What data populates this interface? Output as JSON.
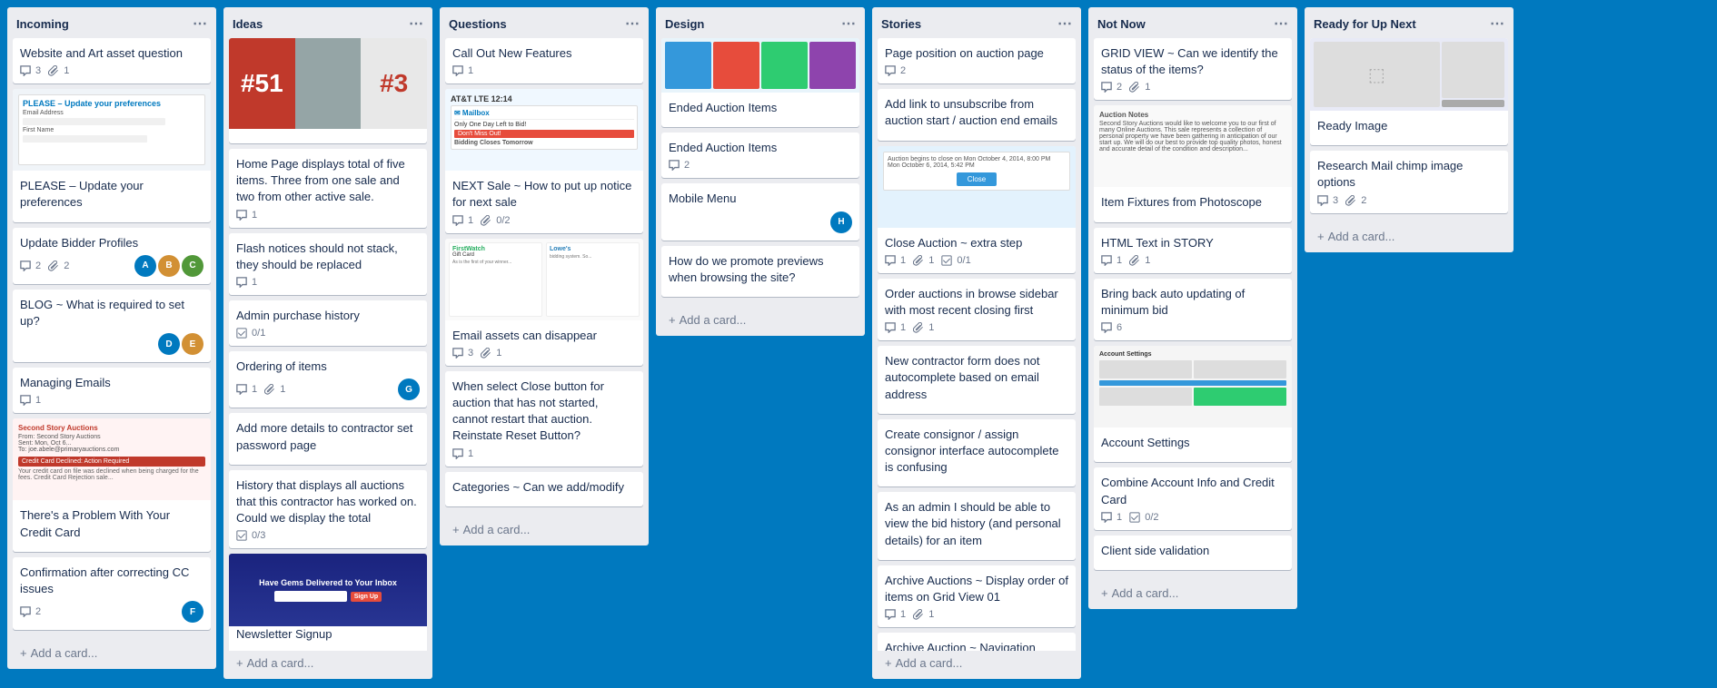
{
  "board": {
    "background": "#0079bf",
    "columns": [
      {
        "id": "incoming",
        "title": "Incoming",
        "cards": [
          {
            "id": "c1",
            "title": "Website and Art asset question",
            "comments": 3,
            "attachments": 1,
            "hasImage": false,
            "imageType": null,
            "avatars": [],
            "labels": []
          },
          {
            "id": "c2",
            "title": "PLEASE – Update your preferences",
            "hasImage": true,
            "imageType": "email-prefs",
            "comments": 0,
            "attachments": 0,
            "avatars": [],
            "labels": []
          },
          {
            "id": "c3",
            "title": "Update Bidder Profiles",
            "hasImage": false,
            "comments": 2,
            "attachments": 2,
            "avatars": [
              "A",
              "B",
              "C"
            ],
            "labels": []
          },
          {
            "id": "c4",
            "title": "BLOG ~ What is required to set up?",
            "hasImage": false,
            "comments": 0,
            "attachments": 0,
            "avatars": [
              "D",
              "E"
            ],
            "labels": []
          },
          {
            "id": "c5",
            "title": "Managing Emails",
            "hasImage": false,
            "comments": 1,
            "attachments": 0,
            "avatars": [],
            "labels": []
          },
          {
            "id": "c6",
            "title": "There's a Problem With Your Credit Card",
            "hasImage": true,
            "imageType": "credit-card",
            "comments": 0,
            "attachments": 0,
            "avatars": [],
            "labels": []
          },
          {
            "id": "c7",
            "title": "Confirmation after correcting CC issues",
            "hasImage": false,
            "comments": 2,
            "attachments": 0,
            "avatars": [
              "F"
            ],
            "labels": []
          }
        ]
      },
      {
        "id": "ideas",
        "title": "Ideas",
        "cards": [
          {
            "id": "i1",
            "title": "",
            "hasImage": true,
            "imageType": "ideas-top",
            "comments": 0,
            "attachments": 0,
            "avatars": [],
            "labels": []
          },
          {
            "id": "i2",
            "title": "Home Page displays total of five items. Three from one sale and two from other active sale.",
            "hasImage": false,
            "comments": 1,
            "attachments": 0,
            "avatars": [],
            "labels": []
          },
          {
            "id": "i3",
            "title": "Flash notices should not stack, they should be replaced",
            "hasImage": false,
            "comments": 1,
            "attachments": 0,
            "avatars": [],
            "labels": []
          },
          {
            "id": "i4",
            "title": "Admin purchase history",
            "hasImage": false,
            "comments": 0,
            "checklist": "0/1",
            "attachments": 0,
            "avatars": [],
            "labels": []
          },
          {
            "id": "i5",
            "title": "Ordering of items",
            "hasImage": false,
            "comments": 1,
            "attachments": 1,
            "avatars": [
              "G"
            ],
            "labels": []
          },
          {
            "id": "i6",
            "title": "Add more details to contractor set password page",
            "hasImage": false,
            "comments": 0,
            "attachments": 0,
            "avatars": [],
            "labels": [],
            "hasChecklist": true
          },
          {
            "id": "i7",
            "title": "History that displays all auctions that this contractor has worked on. Could we display the total",
            "hasImage": false,
            "comments": 0,
            "checklist": "0/3",
            "attachments": 0,
            "avatars": [],
            "labels": []
          },
          {
            "id": "i8",
            "title": "",
            "hasImage": true,
            "imageType": "newsletter",
            "comments": 0,
            "attachments": 0,
            "avatars": [],
            "labels": [],
            "cardTitle": "Newsletter Signup"
          }
        ]
      },
      {
        "id": "questions",
        "title": "Questions",
        "cards": [
          {
            "id": "q1",
            "title": "Call Out New Features",
            "hasImage": false,
            "comments": 1,
            "attachments": 0,
            "avatars": [],
            "labels": []
          },
          {
            "id": "q2",
            "title": "NEXT Sale ~ How to put up notice for next sale",
            "hasImage": true,
            "imageType": "next-sale",
            "comments": 1,
            "attachments": "0/2",
            "avatars": [],
            "labels": []
          },
          {
            "id": "q3",
            "title": "",
            "hasImage": true,
            "imageType": "phone-bid",
            "comments": 3,
            "attachments": 1,
            "avatars": [],
            "labels": [],
            "cardTitle": "Email assets can disappear"
          },
          {
            "id": "q4",
            "title": "When select Close button for auction that has not started, cannot restart that auction. Reinstate Reset Button?",
            "hasImage": false,
            "comments": 1,
            "attachments": 0,
            "avatars": [],
            "labels": []
          },
          {
            "id": "q5",
            "title": "Categories ~ Can we add/modify",
            "hasImage": false,
            "comments": 0,
            "attachments": 0,
            "avatars": [],
            "labels": []
          }
        ]
      },
      {
        "id": "design",
        "title": "Design",
        "cards": [
          {
            "id": "d1",
            "title": "",
            "hasImage": true,
            "imageType": "design-items",
            "comments": 0,
            "attachments": 0,
            "avatars": [],
            "labels": [],
            "cardTitle": "Ended Auction Items"
          },
          {
            "id": "d2",
            "title": "Ended Auction Items",
            "hasImage": false,
            "comments": 2,
            "attachments": 0,
            "avatars": [],
            "labels": []
          },
          {
            "id": "d3",
            "title": "Mobile Menu",
            "hasImage": false,
            "comments": 0,
            "attachments": 0,
            "avatars": [
              "H"
            ],
            "labels": []
          },
          {
            "id": "d4",
            "title": "How do we promote previews when browsing the site?",
            "hasImage": false,
            "comments": 0,
            "attachments": 0,
            "avatars": [],
            "labels": []
          },
          {
            "id": "d5",
            "title": "Add a card…",
            "isAddCard": true
          }
        ]
      },
      {
        "id": "stories",
        "title": "Stories",
        "cards": [
          {
            "id": "s1",
            "title": "Page position on auction page",
            "hasImage": false,
            "comments": 2,
            "attachments": 0,
            "avatars": [],
            "labels": []
          },
          {
            "id": "s2",
            "title": "Add link to unsubscribe from auction start / auction end emails",
            "hasImage": false,
            "comments": 0,
            "attachments": 0,
            "avatars": [],
            "labels": []
          },
          {
            "id": "s3",
            "title": "",
            "hasImage": true,
            "imageType": "story-close",
            "comments": 1,
            "attachments": 1,
            "checklist": "0/1",
            "avatars": [],
            "labels": [],
            "cardTitle": "Close Auction ~ extra step"
          },
          {
            "id": "s4",
            "title": "Order auctions in browse sidebar with most recent closing first",
            "hasImage": false,
            "comments": 1,
            "attachments": 1,
            "avatars": [],
            "labels": []
          },
          {
            "id": "s5",
            "title": "New contractor form does not autocomplete based on email address",
            "hasImage": false,
            "comments": 0,
            "attachments": 0,
            "avatars": [],
            "labels": []
          },
          {
            "id": "s6",
            "title": "Create consignor / assign consignor interface autocomplete is confusing",
            "hasImage": false,
            "comments": 0,
            "attachments": 0,
            "avatars": [],
            "labels": []
          },
          {
            "id": "s7",
            "title": "As an admin I should be able to view the bid history (and personal details) for an item",
            "hasImage": false,
            "comments": 0,
            "attachments": 0,
            "avatars": [],
            "labels": []
          },
          {
            "id": "s8",
            "title": "Archive Auctions ~ Display order of items on Grid View 01",
            "hasImage": false,
            "comments": 1,
            "attachments": 1,
            "avatars": [],
            "labels": []
          },
          {
            "id": "s9",
            "title": "Archive Auction ~ Navigation",
            "hasImage": false,
            "comments": 0,
            "attachments": 0,
            "avatars": [],
            "labels": []
          }
        ]
      },
      {
        "id": "not-now",
        "title": "Not Now",
        "cards": [
          {
            "id": "n1",
            "title": "GRID VIEW ~ Can we identify the status of the items?",
            "hasImage": false,
            "comments": 2,
            "attachments": 1,
            "avatars": [],
            "labels": []
          },
          {
            "id": "n2",
            "title": "",
            "hasImage": true,
            "imageType": "story-notes",
            "comments": 0,
            "attachments": 0,
            "avatars": [],
            "labels": [],
            "cardTitle": "Item Fixtures from Photoscope"
          },
          {
            "id": "n3",
            "title": "HTML Text in STORY",
            "hasImage": false,
            "comments": 1,
            "attachments": 1,
            "avatars": [],
            "labels": []
          },
          {
            "id": "n4",
            "title": "Bring back auto updating of minimum bid",
            "hasImage": false,
            "comments": 6,
            "attachments": 0,
            "avatars": [],
            "labels": []
          },
          {
            "id": "n5",
            "title": "",
            "hasImage": true,
            "imageType": "not-now-grid",
            "comments": 0,
            "attachments": 0,
            "avatars": [],
            "labels": [],
            "cardTitle": "Account Settings"
          },
          {
            "id": "n6",
            "title": "Combine Account Info and Credit Card",
            "hasImage": false,
            "comments": 1,
            "checklist": "0/2",
            "attachments": 0,
            "avatars": [],
            "labels": []
          },
          {
            "id": "n7",
            "title": "Client side validation",
            "hasImage": false,
            "comments": 0,
            "attachments": 0,
            "avatars": [],
            "labels": []
          }
        ]
      },
      {
        "id": "ready",
        "title": "Ready for Up Next",
        "cards": [
          {
            "id": "r1",
            "title": "",
            "hasImage": true,
            "imageType": "ready-img",
            "comments": 0,
            "attachments": 0,
            "avatars": [],
            "labels": [],
            "cardTitle": "Ready Image"
          },
          {
            "id": "r2",
            "title": "Research Mail chimp image options",
            "hasImage": false,
            "comments": 3,
            "attachments": 2,
            "avatars": [],
            "labels": []
          },
          {
            "id": "r3",
            "title": "Add a card…",
            "isAddCard": true
          }
        ]
      }
    ]
  },
  "ui": {
    "add_card_label": "+ Add a card...",
    "ellipsis_icon": "…",
    "comment_icon": "💬",
    "attachment_icon": "📎",
    "checklist_icon": "☑"
  }
}
